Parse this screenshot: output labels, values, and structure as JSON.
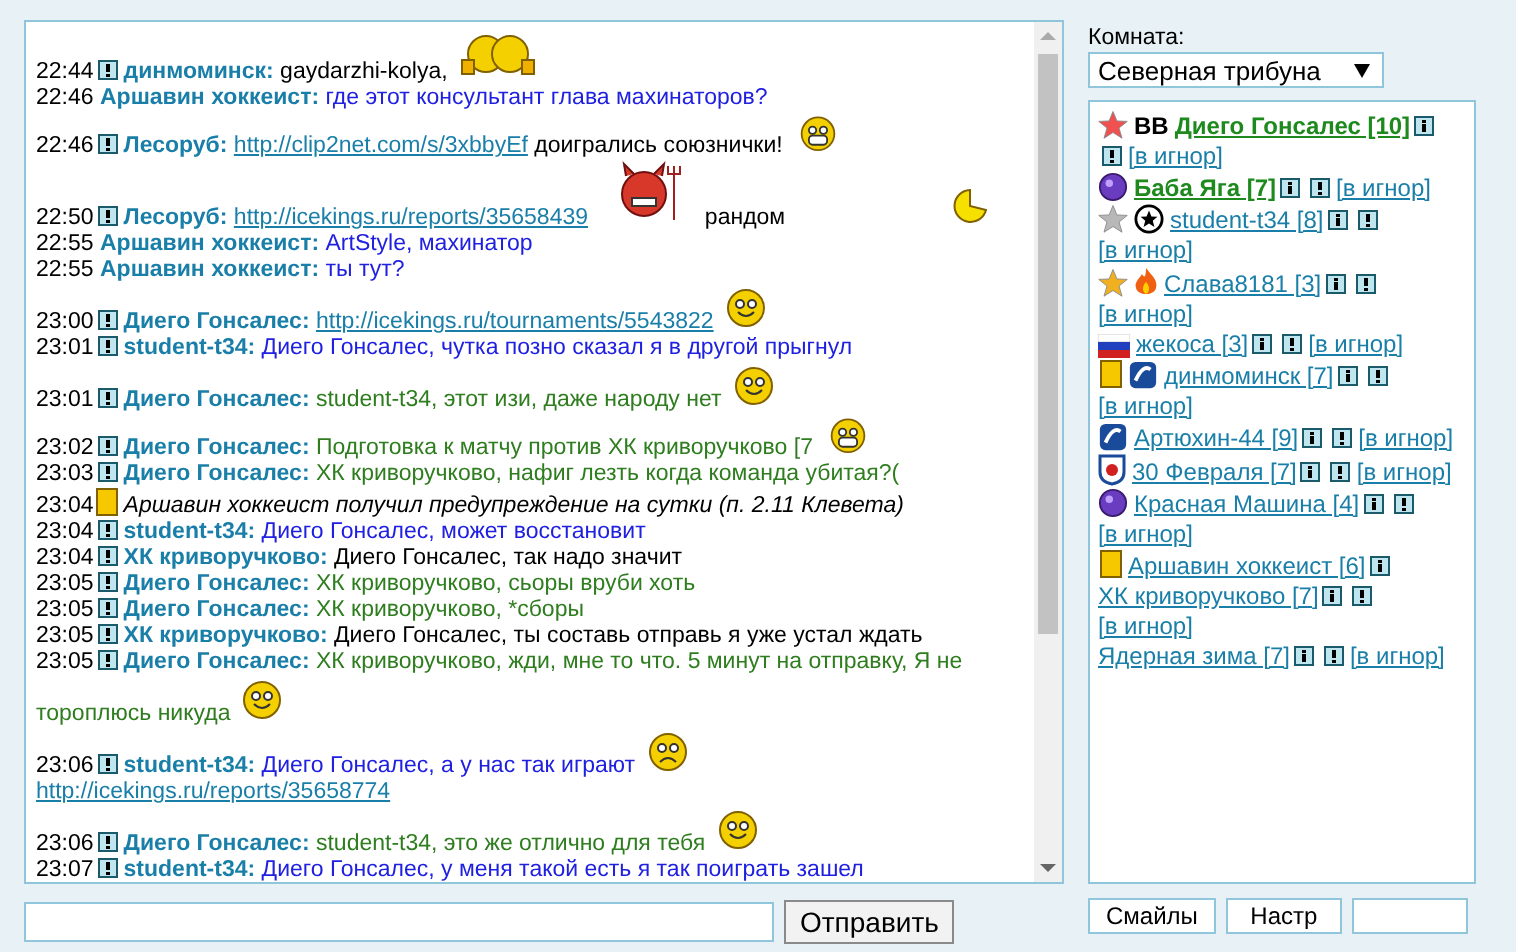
{
  "chat": {
    "messages": [
      {
        "kind": "message",
        "time": "22:44",
        "reply_button": true,
        "nick": "динмоминск:",
        "color": "#000000",
        "parts": [
          {
            "kind": "text",
            "text": "gaydarzhi-kolya,"
          },
          {
            "kind": "beers"
          }
        ]
      },
      {
        "kind": "message",
        "time": "22:46",
        "reply_button": false,
        "nick": "Аршавин хоккеист:",
        "color": "#2020e0",
        "parts": [
          {
            "kind": "text",
            "text": "где этот консультант глава махинаторов?"
          }
        ]
      },
      {
        "kind": "message",
        "time": "22:46",
        "reply_button": true,
        "nick": "Лесоруб:",
        "color": "#000000",
        "parts": [
          {
            "kind": "link",
            "text": "http://clip2net.com/s/3xbbyEf"
          },
          {
            "kind": "text",
            "text": "доигрались союзнички!"
          },
          {
            "kind": "grin"
          }
        ]
      },
      {
        "kind": "message",
        "time": "22:50",
        "reply_button": true,
        "nick": "Лесоруб:",
        "color": "#000000",
        "parts": [
          {
            "kind": "link",
            "text": "http://icekings.ru/reports/35658439"
          },
          {
            "kind": "devil"
          },
          {
            "kind": "text",
            "text": "рандом"
          },
          {
            "kind": "pacman"
          }
        ]
      },
      {
        "kind": "message",
        "time": "22:55",
        "reply_button": false,
        "nick": "Аршавин хоккеист:",
        "color": "#2020e0",
        "parts": [
          {
            "kind": "text",
            "text": "ArtStyle, махинатор"
          }
        ]
      },
      {
        "kind": "message",
        "time": "22:55",
        "reply_button": false,
        "nick": "Аршавин хоккеист:",
        "color": "#2020e0",
        "parts": [
          {
            "kind": "text",
            "text": "ты тут?"
          }
        ]
      },
      {
        "kind": "message",
        "time": "23:00",
        "reply_button": true,
        "nick": "Диего Гонсалес:",
        "parts": [
          {
            "kind": "link",
            "text": "http://icekings.ru/tournaments/5543822"
          },
          {
            "kind": "smile"
          }
        ]
      },
      {
        "kind": "message",
        "time": "23:01",
        "reply_button": true,
        "nick": "student-t34:",
        "color": "#2020e0",
        "parts": [
          {
            "kind": "text",
            "text": "Диего Гонсалес, чутка позно сказал я в другой прыгнул"
          }
        ]
      },
      {
        "kind": "message",
        "time": "23:01",
        "reply_button": true,
        "nick": "Диего Гонсалес:",
        "color": "#2e7d1e",
        "parts": [
          {
            "kind": "text",
            "text": "student-t34, этот изи, даже народу нет"
          },
          {
            "kind": "smile"
          }
        ]
      },
      {
        "kind": "message",
        "time": "23:02",
        "reply_button": true,
        "nick": "Диего Гонсалес:",
        "color": "#2e7d1e",
        "parts": [
          {
            "kind": "text",
            "text": "Подготовка к матчу против ХК криворучково [7"
          },
          {
            "kind": "grin"
          }
        ]
      },
      {
        "kind": "message",
        "time": "23:03",
        "reply_button": true,
        "nick": "Диего Гонсалес:",
        "color": "#2e7d1e",
        "parts": [
          {
            "kind": "text",
            "text": "ХК криворучково, нафиг лезть когда команда убитая?("
          }
        ]
      },
      {
        "kind": "notice",
        "time": "23:04",
        "text": "Аршавин хоккеист получил предупреждение на сутки (п. 2.11 Клевета)"
      },
      {
        "kind": "message",
        "time": "23:04",
        "reply_button": true,
        "nick": "student-t34:",
        "color": "#2020e0",
        "parts": [
          {
            "kind": "text",
            "text": "Диего Гонсалес, может восстановит"
          }
        ]
      },
      {
        "kind": "message",
        "time": "23:04",
        "reply_button": true,
        "nick": "ХК криворучково:",
        "color": "#000000",
        "parts": [
          {
            "kind": "text",
            "text": "Диего Гонсалес, так надо значит"
          }
        ]
      },
      {
        "kind": "message",
        "time": "23:05",
        "reply_button": true,
        "nick": "Диего Гонсалес:",
        "color": "#2e7d1e",
        "parts": [
          {
            "kind": "text",
            "text": "ХК криворучково, сьоры вруби хоть"
          }
        ]
      },
      {
        "kind": "message",
        "time": "23:05",
        "reply_button": true,
        "nick": "Диего Гонсалес:",
        "color": "#2e7d1e",
        "parts": [
          {
            "kind": "text",
            "text": "ХК криворучково, *сборы"
          }
        ]
      },
      {
        "kind": "message",
        "time": "23:05",
        "reply_button": true,
        "nick": "ХК криворучково:",
        "color": "#000000",
        "parts": [
          {
            "kind": "text",
            "text": "Диего Гонсалес, ты составь отправь я уже устал ждать"
          }
        ]
      },
      {
        "kind": "message",
        "time": "23:05",
        "reply_button": true,
        "nick": "Диего Гонсалес:",
        "color": "#2e7d1e",
        "parts": [
          {
            "kind": "text",
            "text": "ХК криворучково, жди, мне то что. 5 минут на отправку, Я не"
          },
          {
            "kind": "text",
            "text": "тороплюсь никуда"
          },
          {
            "kind": "smile"
          }
        ]
      },
      {
        "kind": "message",
        "time": "23:06",
        "reply_button": true,
        "nick": "student-t34:",
        "color": "#2020e0",
        "parts": [
          {
            "kind": "text",
            "text": "Диего Гонсалес, а у нас так играют"
          },
          {
            "kind": "sad"
          },
          {
            "kind": "link",
            "text": "http://icekings.ru/reports/35658774"
          }
        ]
      },
      {
        "kind": "message",
        "time": "23:06",
        "reply_button": true,
        "nick": "Диего Гонсалес:",
        "color": "#2e7d1e",
        "parts": [
          {
            "kind": "text",
            "text": "student-t34, это же отлично для тебя"
          },
          {
            "kind": "smile"
          }
        ]
      },
      {
        "kind": "message",
        "time": "23:07",
        "reply_button": true,
        "nick": "student-t34:",
        "color": "#2020e0",
        "parts": [
          {
            "kind": "text",
            "text": "Диего Гонсалес, у меня такой есть я так поиграть зашел"
          }
        ]
      }
    ]
  },
  "send_button": "Отправить",
  "room": {
    "label": "Комната:",
    "value": "Северная трибуна"
  },
  "users": [
    {
      "badges": [
        {
          "kind": "star",
          "color": "#f05050"
        },
        {
          "kind": "text",
          "text": "ВВ"
        }
      ],
      "name": "Диего Гонсалес [10]",
      "highlighted": true,
      "info": true,
      "private": true,
      "ignore": "[в игнор]"
    },
    {
      "badges": [
        {
          "kind": "ball"
        }
      ],
      "name": "Баба Яга [7]",
      "highlighted": true,
      "info": true,
      "private": true,
      "ignore": "[в игнор]"
    },
    {
      "badges": [
        {
          "kind": "star",
          "color": "#b8b8b8"
        },
        {
          "kind": "emblem"
        }
      ],
      "name": "student-t34 [8]",
      "highlighted": false,
      "info": true,
      "private": true,
      "ignore": "[в игнор]"
    },
    {
      "badges": [
        {
          "kind": "star",
          "color": "#f0b020"
        },
        {
          "kind": "fire"
        }
      ],
      "name": "Слава8181 [3]",
      "highlighted": false,
      "info": true,
      "private": true,
      "ignore": "[в игнор]"
    },
    {
      "badges": [
        {
          "kind": "flag"
        }
      ],
      "name": "жекоса [3]",
      "highlighted": false,
      "info": true,
      "private": true,
      "ignore": "[в игнор]"
    },
    {
      "badges": [
        {
          "kind": "card"
        },
        {
          "kind": "logo"
        }
      ],
      "name": "динмоминск [7]",
      "highlighted": false,
      "info": true,
      "private": true,
      "ignore": "[в игнор]"
    },
    {
      "badges": [
        {
          "kind": "logo"
        }
      ],
      "name": "Артюхин-44 [9]",
      "highlighted": false,
      "info": true,
      "private": true,
      "ignore": "[в игнор]"
    },
    {
      "badges": [
        {
          "kind": "shield"
        }
      ],
      "name": "30 Февраля [7]",
      "highlighted": false,
      "info": true,
      "private": true,
      "ignore": "[в игнор]"
    },
    {
      "badges": [
        {
          "kind": "ball"
        }
      ],
      "name": "Красная Машина [4]",
      "highlighted": false,
      "info": true,
      "private": true,
      "ignore": "[в игнор]"
    },
    {
      "badges": [
        {
          "kind": "card"
        }
      ],
      "name": "Аршавин хоккеист [6]",
      "highlighted": false,
      "info": true,
      "private": false
    },
    {
      "name": "ХК криворучково [7]",
      "highlighted": false,
      "info": true,
      "private": true,
      "ignore": "[в игнор]"
    },
    {
      "name": "Ядерная зима [7]",
      "highlighted": false,
      "info": true,
      "private": true,
      "ignore": "[в игнор]"
    }
  ],
  "panel_buttons": [
    "Смайлы",
    "Настр"
  ]
}
